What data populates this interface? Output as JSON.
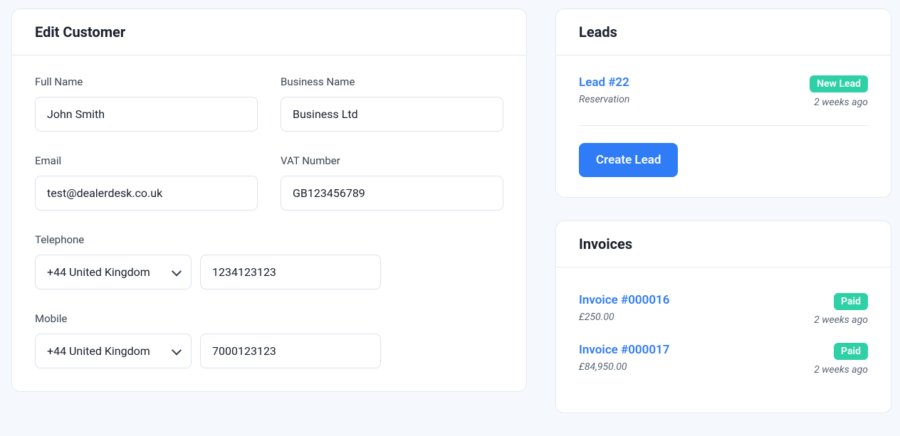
{
  "editCustomer": {
    "title": "Edit Customer",
    "fields": {
      "fullName": {
        "label": "Full Name",
        "value": "John Smith"
      },
      "businessName": {
        "label": "Business Name",
        "value": "Business Ltd"
      },
      "email": {
        "label": "Email",
        "value": "test@dealerdesk.co.uk"
      },
      "vatNumber": {
        "label": "VAT Number",
        "value": "GB123456789"
      },
      "telephone": {
        "label": "Telephone",
        "countryCode": "+44 United Kingdom",
        "number": "1234123123"
      },
      "mobile": {
        "label": "Mobile",
        "countryCode": "+44 United Kingdom",
        "number": "7000123123"
      }
    }
  },
  "leads": {
    "title": "Leads",
    "items": [
      {
        "title": "Lead #22",
        "subtitle": "Reservation",
        "badge": "New Lead",
        "time": "2 weeks ago"
      }
    ],
    "createButton": "Create Lead"
  },
  "invoices": {
    "title": "Invoices",
    "items": [
      {
        "title": "Invoice #000016",
        "amount": "£250.00",
        "badge": "Paid",
        "time": "2 weeks ago"
      },
      {
        "title": "Invoice #000017",
        "amount": "£84,950.00",
        "badge": "Paid",
        "time": "2 weeks ago"
      }
    ]
  },
  "colors": {
    "accent": "#2f7cf6",
    "badgeSuccess": "#2fd0a6"
  }
}
